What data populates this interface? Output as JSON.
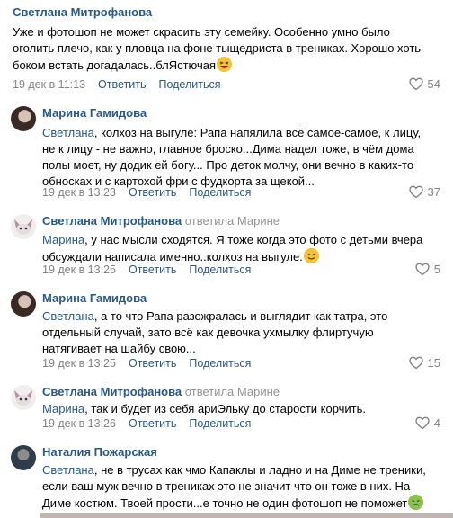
{
  "comments": [
    {
      "author": "Светлана Митрофанова",
      "lines": [
        "Уже и фотошоп не может скрасить эту семейку. Особенно умно было",
        "оголить плечо, как у пловца на фоне тыщедриста в трениках. Хорошо хоть",
        "боком встать догадалась..блЯстючая"
      ],
      "date": "19 дек в 11:13",
      "reply_label": "Ответить",
      "share_label": "Поделиться",
      "likes": "54"
    },
    {
      "author": "Марина Гамидова",
      "lines": [
        "Светлана, колхоз на выгуле: Рапа напялила всё самое-самое, к лицу,",
        "не к лицу - не важно, главное броско...Дима надел тоже, в чём дома",
        "полы моет, ну додик ей богу... Про деток молчу, они вечно в каких-то",
        "обносках и с картохой фри с фудкорта за щекой..."
      ],
      "mention": "Светлана",
      "first_line_rest": ", колхоз на выгуле: Рапа напялила всё самое-самое, к лицу,",
      "date": "19 дек в 13:23",
      "reply_label": "Ответить",
      "share_label": "Поделиться",
      "likes": "37"
    },
    {
      "author": "Светлана Митрофанова",
      "replied_to": "ответила Марине",
      "mention": "Марина",
      "first_line_rest": ", у нас мысли сходятся. Я тоже когда это фото с детьми вчера",
      "lines": [
        "Марина, у нас мысли сходятся. Я тоже когда это фото с детьми вчера",
        "обсуждали написала именно..колхоз на выгуле."
      ],
      "date": "19 дек в 13:25",
      "reply_label": "Ответить",
      "share_label": "Поделиться",
      "likes": "5"
    },
    {
      "author": "Марина Гамидова",
      "mention": "Светлана",
      "first_line_rest": ", а то что Рапа разожралась и выглядит как татра, это",
      "lines": [
        "Светлана, а то что Рапа разожралась и выглядит как татра, это",
        "отдельный случай, зато всё как девочка ухмылку флиртучую",
        "натягивает на шайбу свою..."
      ],
      "date": "19 дек в 13:25",
      "reply_label": "Ответить",
      "share_label": "Поделиться",
      "likes": "15"
    },
    {
      "author": "Светлана Митрофанова",
      "replied_to": "ответила Марине",
      "mention": "Марина",
      "first_line_rest": ", так и будет из себя ариЭльку до старости корчить.",
      "lines": [
        "Марина, так и будет из себя ариЭльку до старости корчить."
      ],
      "date": "19 дек в 13:26",
      "reply_label": "Ответить",
      "share_label": "Поделиться",
      "likes": "4"
    },
    {
      "author": "Наталия Пожарская",
      "mention": "Светлана",
      "first_line_rest": ", не в трусах как чмо Капаклы и ладно и на Диме не треники,",
      "lines": [
        "Светлана, не в трусах как чмо Капаклы и ладно и на Диме не треники,",
        "если ваш муж вечно в трениках это не значит что он тоже в них. На",
        "Диме костюм. Твоей прости...е точно не один фотошоп не поможет"
      ]
    }
  ],
  "icons": {
    "like": "heart-outline-icon",
    "laugh": "laughing-emoji-icon",
    "smile": "smile-emoji-icon",
    "sick": "nauseated-emoji-icon"
  },
  "colors": {
    "link": "#2a5885",
    "meta": "#828282"
  }
}
